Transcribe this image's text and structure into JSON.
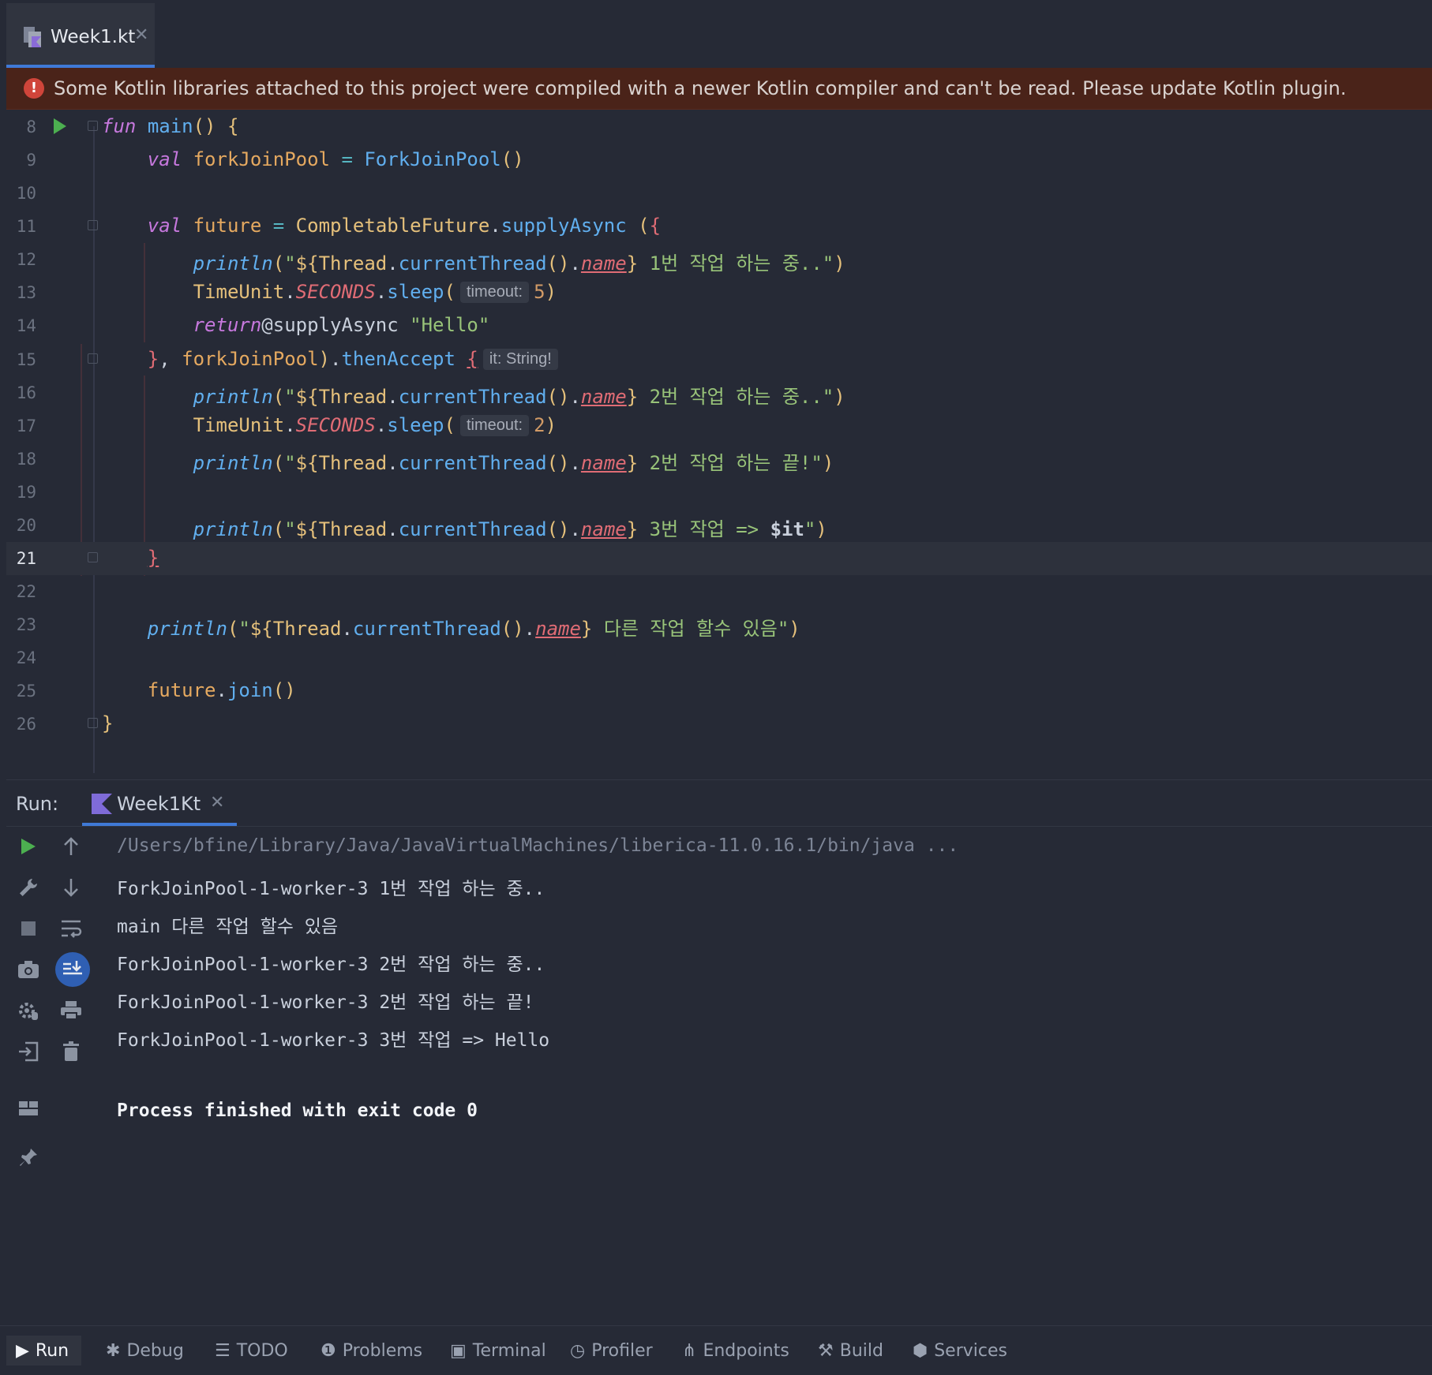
{
  "tabs": {
    "file_tab": "Week1.kt"
  },
  "banner": {
    "text": "Some Kotlin libraries attached to this project were compiled with a newer Kotlin compiler and can't be read. Please update Kotlin plugin."
  },
  "editor": {
    "lines": [
      {
        "n": "8"
      },
      {
        "n": "9"
      },
      {
        "n": "10"
      },
      {
        "n": "11"
      },
      {
        "n": "12"
      },
      {
        "n": "13"
      },
      {
        "n": "14"
      },
      {
        "n": "15"
      },
      {
        "n": "16"
      },
      {
        "n": "17"
      },
      {
        "n": "18"
      },
      {
        "n": "19"
      },
      {
        "n": "20"
      },
      {
        "n": "21"
      },
      {
        "n": "22"
      },
      {
        "n": "23"
      },
      {
        "n": "24"
      },
      {
        "n": "25"
      },
      {
        "n": "26"
      }
    ],
    "current_line": "21",
    "hints": {
      "timeout": "timeout:",
      "it_type": "it: String!"
    },
    "strings": {
      "s12": " 1번 작업 하는 중..",
      "s16": " 2번 작업 하는 중..",
      "s18": " 2번 작업 하는 끝!",
      "s20": " 3번 작업 => ",
      "s23": " 다른 작업 할수 있음",
      "hello": "\"Hello\""
    },
    "numbers": {
      "n5": "5",
      "n2": "2"
    }
  },
  "run_panel": {
    "label": "Run:",
    "tab": "Week1Kt",
    "console": [
      "/Users/bfine/Library/Java/JavaVirtualMachines/liberica-11.0.16.1/bin/java ...",
      "ForkJoinPool-1-worker-3 1번 작업 하는 중..",
      "main 다른 작업 할수 있음",
      "ForkJoinPool-1-worker-3 2번 작업 하는 중..",
      "ForkJoinPool-1-worker-3 2번 작업 하는 끝!",
      "ForkJoinPool-1-worker-3 3번 작업 => Hello",
      "",
      "Process finished with exit code 0"
    ]
  },
  "bottom_bar": {
    "items": [
      "Run",
      "Debug",
      "TODO",
      "Problems",
      "Terminal",
      "Profiler",
      "Endpoints",
      "Build",
      "Services"
    ],
    "active": "Run"
  },
  "colors": {
    "accent": "#3f79d6",
    "error": "#d0453a",
    "run_green": "#4caf50",
    "background": "#262a36"
  }
}
